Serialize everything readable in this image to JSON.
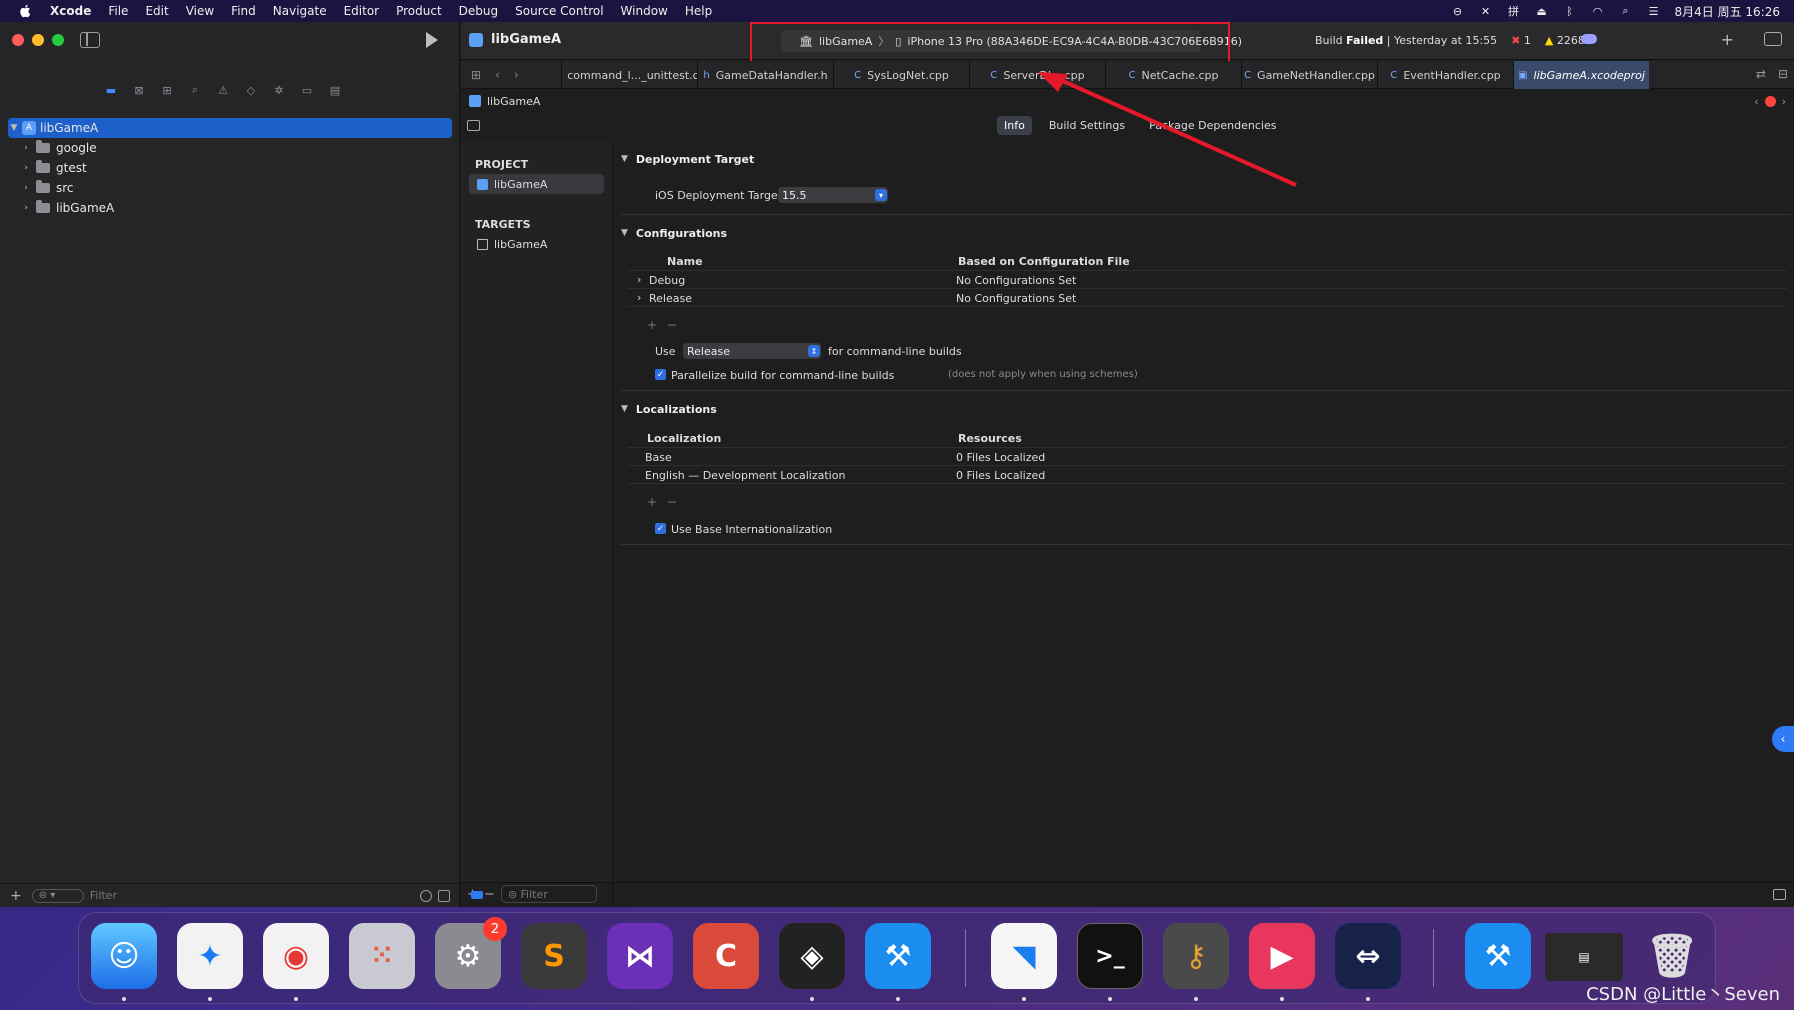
{
  "menubar": {
    "app": "Xcode",
    "items": [
      "File",
      "Edit",
      "View",
      "Find",
      "Navigate",
      "Editor",
      "Product",
      "Debug",
      "Source Control",
      "Window",
      "Help"
    ],
    "clock": "8月4日 周五 16:26"
  },
  "navigator": {
    "items": [
      {
        "label": "libGameA",
        "selected": true
      },
      {
        "label": "google"
      },
      {
        "label": "gtest"
      },
      {
        "label": "src"
      },
      {
        "label": "libGameA"
      }
    ],
    "filter_placeholder": "Filter"
  },
  "toolbar": {
    "project": "libGameA",
    "scheme": "libGameA",
    "device": "iPhone 13 Pro (88A346DE-EC9A-4C4A-B0DB-43C706E6B916)",
    "build_prefix": "Build",
    "build_state": "Failed",
    "build_time": "| Yesterday at 15:55",
    "errors": "1",
    "warnings": "2268"
  },
  "tabs": [
    {
      "label": "command_l..._unittest.cc"
    },
    {
      "label": "GameDataHandler.h"
    },
    {
      "label": "SysLogNet.cpp"
    },
    {
      "label": "ServerDL...cpp"
    },
    {
      "label": "NetCache.cpp"
    },
    {
      "label": "GameNetHandler.cpp"
    },
    {
      "label": "EventHandler.cpp"
    },
    {
      "label": "libGameA.xcodeproj",
      "active": true
    }
  ],
  "jumpbar": {
    "label": "libGameA"
  },
  "segments": [
    "Info",
    "Build Settings",
    "Package Dependencies"
  ],
  "project_list": {
    "project_header": "PROJECT",
    "project_item": "libGameA",
    "targets_header": "TARGETS",
    "target_item": "libGameA",
    "filter_placeholder": "Filter"
  },
  "deployment": {
    "title": "Deployment Target",
    "label": "iOS Deployment Target",
    "value": "15.5"
  },
  "configurations": {
    "title": "Configurations",
    "col_name": "Name",
    "col_based": "Based on Configuration File",
    "rows": [
      {
        "name": "Debug",
        "based": "No Configurations Set"
      },
      {
        "name": "Release",
        "based": "No Configurations Set"
      }
    ],
    "use_label": "Use",
    "use_value": "Release",
    "use_suffix": "for command-line builds",
    "parallel_label": "Parallelize build for command-line builds",
    "parallel_note": "(does not apply when using schemes)"
  },
  "localizations": {
    "title": "Localizations",
    "col_loc": "Localization",
    "col_res": "Resources",
    "rows": [
      {
        "name": "Base",
        "res": "0 Files Localized"
      },
      {
        "name": "English — Development Localization",
        "res": "0 Files Localized"
      }
    ],
    "base_intl": "Use Base Internationalization"
  },
  "dock": {
    "settings_badge": "2"
  },
  "watermark": "CSDN @Little丶Seven",
  "colors": {
    "highlight": "#e6192b",
    "accent": "#2f6fe0",
    "selection": "#1f5fc9"
  }
}
